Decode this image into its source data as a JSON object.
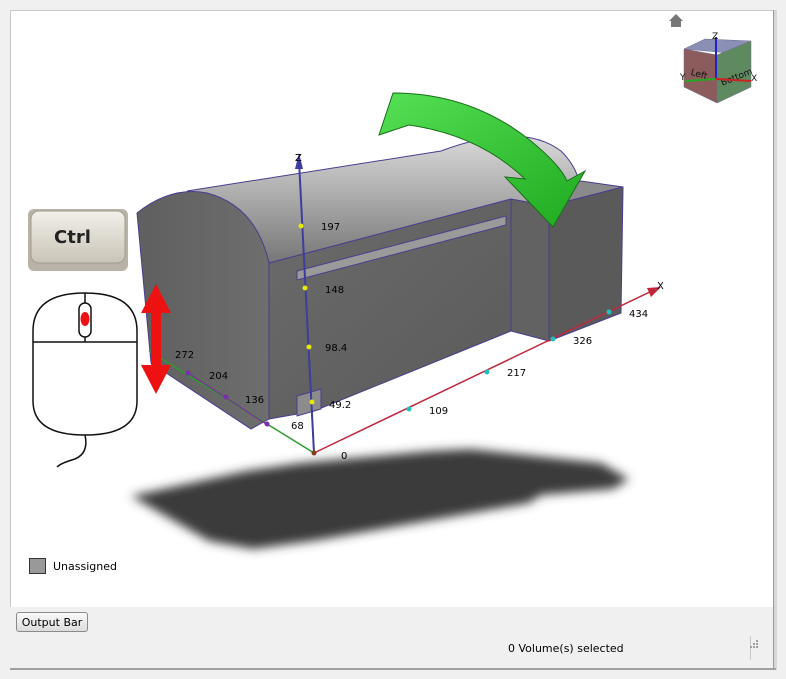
{
  "viewcube": {
    "face_left": "Left",
    "face_bottom": "Bottom",
    "axis_z": "Z",
    "axis_x": "X",
    "axis_y": "Y"
  },
  "axes": {
    "z_label": "Z",
    "x_label": "X",
    "z_ticks": [
      "197",
      "148",
      "98.4",
      "49.2"
    ],
    "x_ticks": [
      "0",
      "109",
      "217",
      "326",
      "434"
    ],
    "y_ticks": [
      "272",
      "204",
      "136",
      "68"
    ]
  },
  "hint": {
    "key_label": "Ctrl"
  },
  "legend": {
    "label": "Unassigned",
    "color": "#999999"
  },
  "buttons": {
    "output_bar": "Output Bar"
  },
  "status": {
    "selection": "0 Volume(s) selected"
  },
  "colors": {
    "green_arrow": "#33cc33",
    "red_arrow": "#ee1111",
    "x_axis": "#c0283c",
    "model_body": "#6a6a6a",
    "model_edge": "#4a3d8f"
  }
}
